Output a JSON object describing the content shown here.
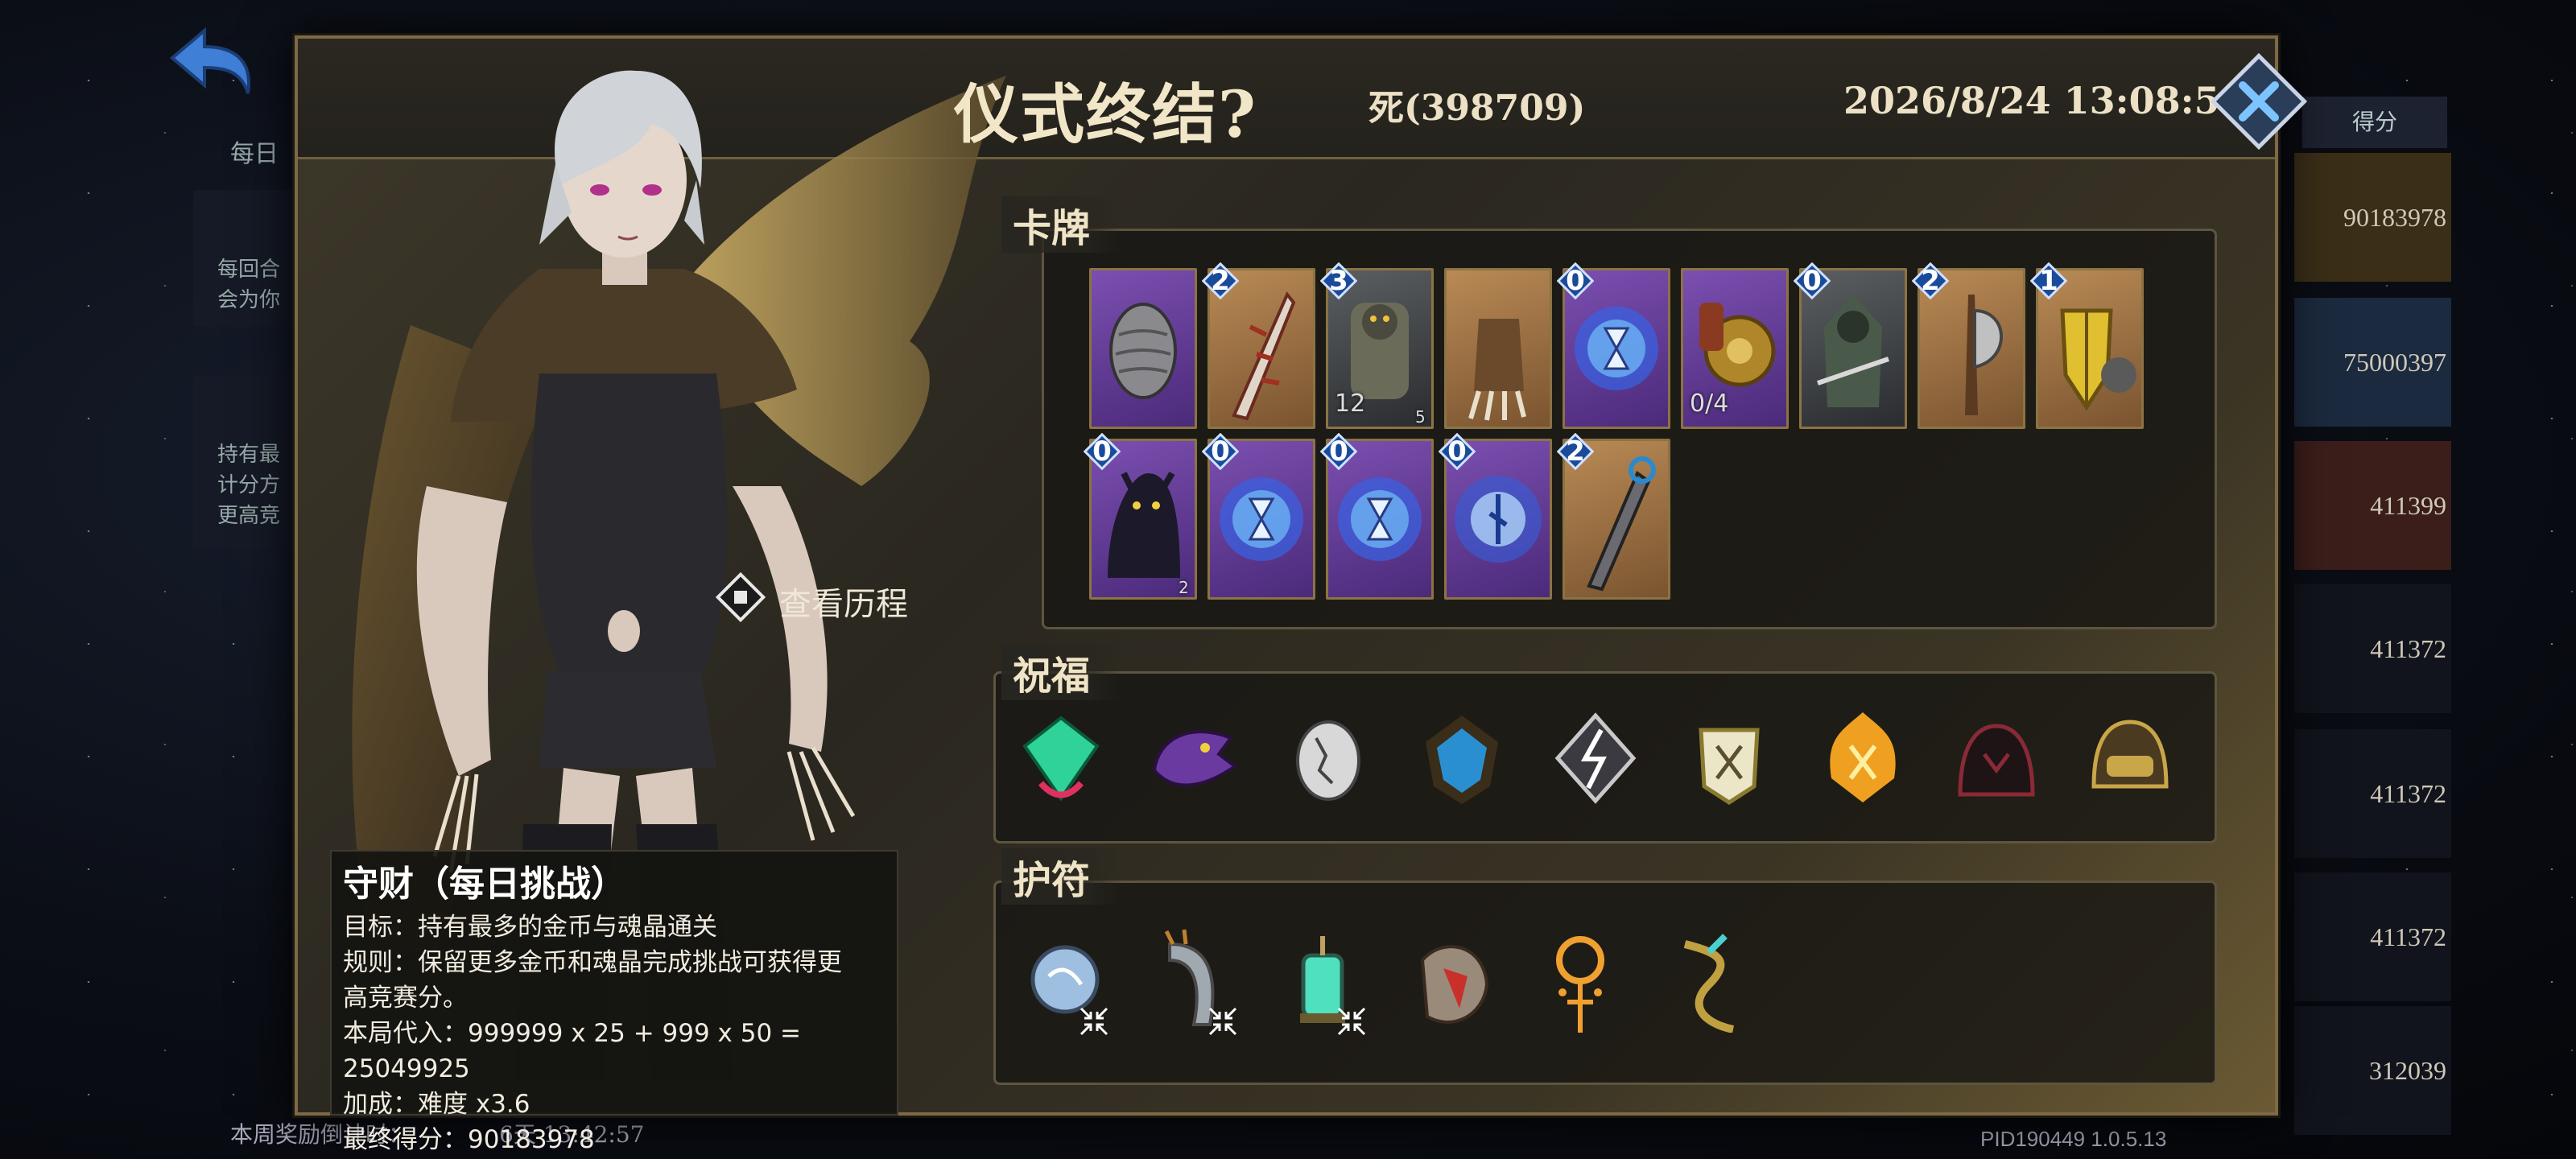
{
  "background": {
    "daily_label": "每日",
    "card1_lines": [
      "每回合",
      "会为你"
    ],
    "card2_lines": [
      "持有最",
      "计分方",
      "更高竞"
    ],
    "bottom_label": "本周奖励倒计时：",
    "bottom_value": "6天 13:42:57",
    "score_header": "得分",
    "scores": [
      "90183978",
      "75000397",
      "411399",
      "411372",
      "411372",
      "411372",
      "312039"
    ],
    "row_colors": [
      "#3a2e16",
      "#1b2a3e",
      "#3b1e1a",
      "#11141c",
      "#11141c",
      "#11141c",
      "#11141c"
    ],
    "version": "PID190449  1.0.5.13"
  },
  "dialog": {
    "title": "仪式终结?",
    "result": "死(398709)",
    "datetime": "2026/8/24 13:08:56",
    "history_label": "查看历程"
  },
  "sections": {
    "cards": "卡牌",
    "blessings": "祝福",
    "amulets": "护符"
  },
  "cards": [
    {
      "icon": "stone-egg-icon",
      "bg": "p",
      "cost": null
    },
    {
      "icon": "bone-dagger-icon",
      "bg": "o",
      "cost": "2"
    },
    {
      "icon": "armored-beast-icon",
      "bg": "g",
      "cost": "3",
      "extra": "12",
      "badge": "5"
    },
    {
      "icon": "claw-gauntlet-icon",
      "bg": "o",
      "cost": null
    },
    {
      "icon": "hourglass-vortex-icon",
      "bg": "p",
      "cost": "0"
    },
    {
      "icon": "golden-shield-icon",
      "bg": "p",
      "cost": null,
      "extra": "0/4"
    },
    {
      "icon": "hooded-knight-icon",
      "bg": "g",
      "cost": "0"
    },
    {
      "icon": "battle-axe-icon",
      "bg": "o",
      "cost": "2"
    },
    {
      "icon": "shield-warrior-icon",
      "bg": "o",
      "cost": "1"
    },
    {
      "icon": "shadow-beast-icon",
      "bg": "p",
      "cost": "0",
      "badge": "2"
    },
    {
      "icon": "hourglass-vortex-icon",
      "bg": "p",
      "cost": "0"
    },
    {
      "icon": "hourglass-vortex-icon",
      "bg": "p",
      "cost": "0"
    },
    {
      "icon": "blue-rune-vortex-icon",
      "bg": "p",
      "cost": "0"
    },
    {
      "icon": "chain-blade-icon",
      "bg": "o",
      "cost": "2"
    }
  ],
  "blessings": [
    {
      "icon": "emerald-gem-icon",
      "color": "#2fd39a"
    },
    {
      "icon": "dragon-head-icon",
      "color": "#6a3aa0"
    },
    {
      "icon": "cracked-egg-icon",
      "color": "#d8d8d8"
    },
    {
      "icon": "blue-crystal-shield-icon",
      "color": "#2a8fd0"
    },
    {
      "icon": "lightning-rune-icon",
      "color": "#c9c9c9"
    },
    {
      "icon": "white-gauntlet-icon",
      "color": "#ece6c8"
    },
    {
      "icon": "flaming-crest-icon",
      "color": "#f0a020"
    },
    {
      "icon": "shadow-demon-icon",
      "color": "#8a2a36"
    },
    {
      "icon": "masked-helm-icon",
      "color": "#c9a648"
    }
  ],
  "amulets": [
    {
      "icon": "crystal-orb-icon",
      "color": "#9fbfe0",
      "merge": true
    },
    {
      "icon": "claw-relic-icon",
      "color": "#a0a8b0",
      "merge": true
    },
    {
      "icon": "lantern-icon",
      "color": "#4fe0c0",
      "merge": true
    },
    {
      "icon": "red-fang-icon",
      "color": "#c8312a",
      "merge": false
    },
    {
      "icon": "golden-ring-icon",
      "color": "#f0a030",
      "merge": false
    },
    {
      "icon": "serpent-staff-icon",
      "color": "#c0a040",
      "merge": false
    }
  ],
  "info": {
    "title": "守财（每日挑战）",
    "lines": [
      "目标：持有最多的金币与魂晶通关",
      "规则：保留更多金币和魂晶完成挑战可获得更",
      "高竞赛分。",
      "本局代入：999999 x 25 + 999 x 50 = 25049925",
      "加成：难度 x3.6",
      "最终得分：90183978"
    ]
  }
}
